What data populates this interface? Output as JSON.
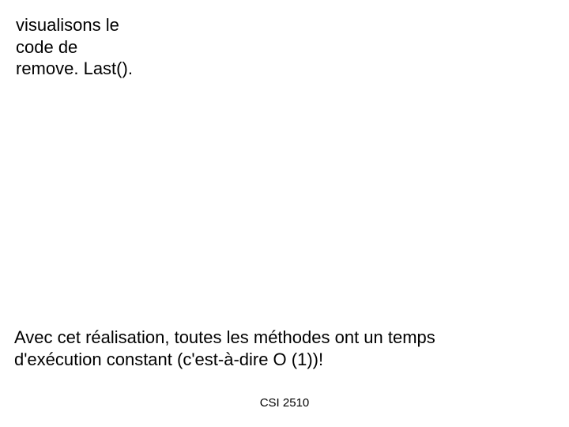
{
  "slide": {
    "top_line1": "visualisons le",
    "top_line2": "code de",
    "top_line3": "remove. Last().",
    "bottom_line1": "Avec cet réalisation, toutes les méthodes ont un temps",
    "bottom_line2": "d'exécution constant (c'est-à-dire O (1))!",
    "footer": "CSI 2510"
  }
}
